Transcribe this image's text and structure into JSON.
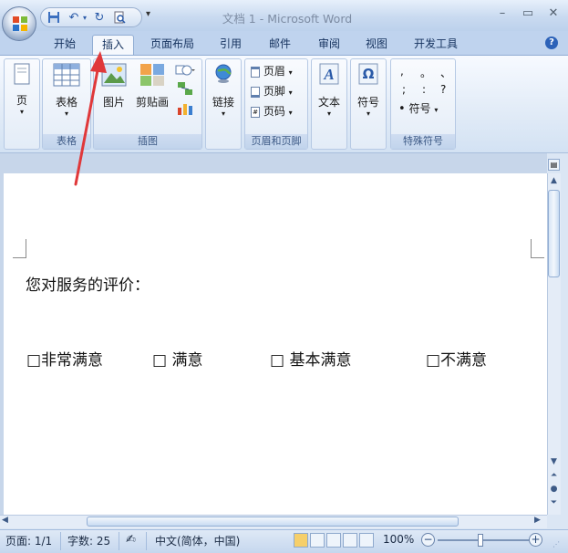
{
  "window": {
    "title": "文档 1 - Microsoft Word"
  },
  "quick_access": {
    "icons": [
      "save-icon",
      "undo-icon",
      "redo-icon",
      "print-preview-icon"
    ]
  },
  "tabs": [
    "开始",
    "插入",
    "页面布局",
    "引用",
    "邮件",
    "审阅",
    "视图",
    "开发工具"
  ],
  "active_tab": "插入",
  "ribbon": {
    "page_btn": "页",
    "table_btn": "表格",
    "group_table": "表格",
    "picture_btn": "图片",
    "clipart_btn": "剪贴画",
    "group_illustration": "插图",
    "link_btn": "链接",
    "header_btn": "页眉",
    "footer_btn": "页脚",
    "page_number_btn": "页码",
    "group_header_footer": "页眉和页脚",
    "text_btn": "文本",
    "symbol_btn": "符号",
    "special_symbols": [
      ",",
      "。",
      "、",
      ";",
      ":",
      "?"
    ],
    "symbol_menu": "符号",
    "group_special": "特殊符号"
  },
  "document": {
    "prompt": "您对服务的评价：",
    "options": [
      "□非常满意",
      "□  满意",
      "□  基本满意",
      "□不满意"
    ]
  },
  "status": {
    "page": "页面: 1/1",
    "words": "字数: 25",
    "language": "中文(简体，中国)",
    "zoom": "100%",
    "zoom_level": 1.0
  },
  "colors": {
    "annotation_arrow": "#e0383a",
    "ribbon_accent": "#2a5aa8"
  }
}
